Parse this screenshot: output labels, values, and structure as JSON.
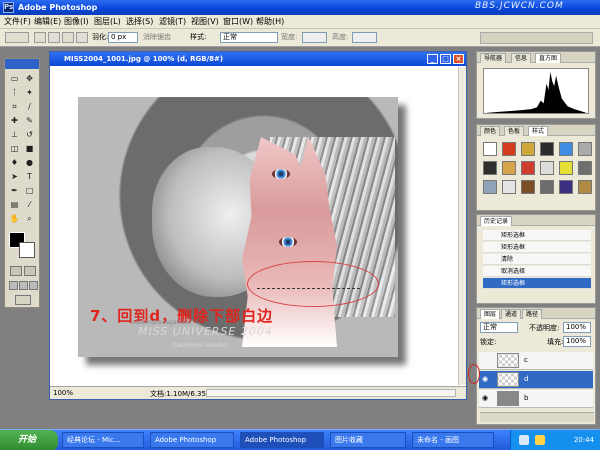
{
  "app": {
    "title": "Adobe Photoshop",
    "watermark": "BBS.JCWCN.COM"
  },
  "menu": [
    "文件(F)",
    "编辑(E)",
    "图像(I)",
    "图层(L)",
    "选择(S)",
    "滤镜(T)",
    "视图(V)",
    "窗口(W)",
    "帮助(H)"
  ],
  "options": {
    "feather_label": "羽化:",
    "feather_value": "0 px",
    "antialias_label": "消除锯齿",
    "style_label": "样式:",
    "style_value": "正常",
    "width_label": "宽度:",
    "height_label": "高度:"
  },
  "doc": {
    "title": "MISS2004_1001.jpg @ 100% (d, RGB/8#)",
    "zoom": "100%",
    "status": "文档:1.10M/6.35M",
    "caption": "7、回到d，删除下部白边",
    "watermark_small": "alexandre lagandior",
    "watermark_big": "MISS UNIVERSE 2004",
    "watermark_small2": "stockholm sweden"
  },
  "panels": {
    "nav_tabs": [
      "导航器",
      "信息",
      "直方图"
    ],
    "swatch_tabs": [
      "颜色",
      "色板",
      "样式"
    ],
    "history_tab": "历史记录",
    "history": [
      "矩形选框",
      "矩形选框",
      "清除",
      "取消选择",
      "矩形选框"
    ],
    "layers_tabs": [
      "图层",
      "通道",
      "路径"
    ],
    "blend_mode": "正常",
    "opacity_label": "不透明度:",
    "opacity_value": "100%",
    "lock_label": "锁定:",
    "fill_label": "填充:",
    "fill_value": "100%",
    "layers": [
      "c",
      "d",
      "b"
    ]
  },
  "taskbar": {
    "start": "开始",
    "tasks": [
      "经典论坛 - Mic...",
      "Adobe Photoshop",
      "Adobe Photoshop",
      "图片收藏",
      "未命名 - 画图"
    ],
    "clock": "20:44"
  },
  "colors": {
    "xp_blue": "#2b6cf0",
    "selected": "#316ac5",
    "caption_red": "#e0241c",
    "selection_ellipse": "#d74343"
  }
}
